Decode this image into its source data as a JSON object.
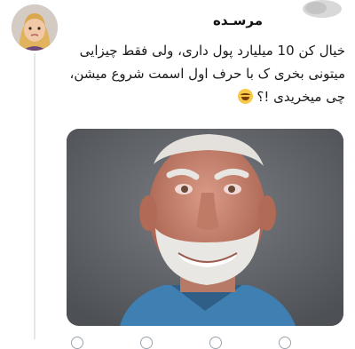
{
  "user": {
    "display_name": "مرسـده",
    "avatar_icon": "user-avatar"
  },
  "tweet": {
    "lines": [
      "خیال کن 10 میلیارد پول داری، ولی فقط چیزایی",
      "میتونی بخری ک با حرف اول اسمت شروع میشن،",
      "چی میخریدی !؟"
    ],
    "emoji": "grinning-sweat-emoji"
  },
  "media": {
    "description_icon": "meme-photo-old-man-smiling"
  },
  "actions": [
    "reply-icon",
    "retweet-icon",
    "like-icon",
    "share-icon"
  ],
  "colors": {
    "text": "#1a1a1a",
    "media_bg": "#5d6064",
    "divider": "#e6e6e6"
  }
}
